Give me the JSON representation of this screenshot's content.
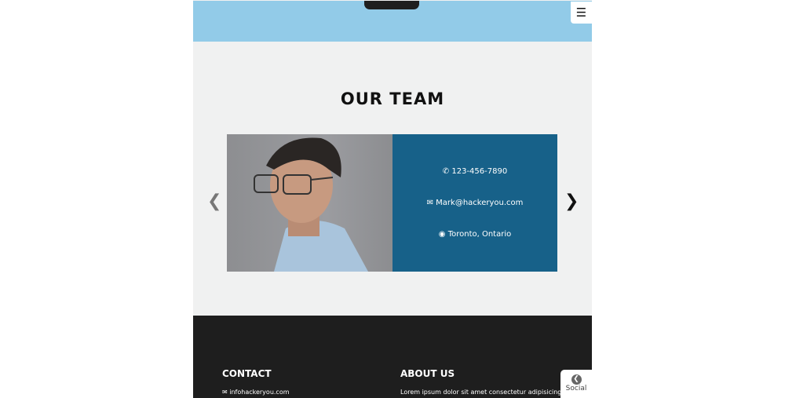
{
  "header": {
    "menu_icon": "hamburger-icon"
  },
  "team": {
    "title": "OUR TEAM",
    "prev_icon": "chevron-left-icon",
    "next_icon": "chevron-right-icon",
    "member": {
      "phone": "123-456-7890",
      "email": "Mark@hackeryou.com",
      "location": "Toronto, Ontario"
    }
  },
  "footer": {
    "contact": {
      "heading": "CONTACT",
      "email": "infohackeryou.com"
    },
    "about": {
      "heading": "ABOUT US",
      "text": "Lorem ipsum dolor sit amet consectetur adipisicing elit. Vitae"
    }
  },
  "social_tab": {
    "label": "Social"
  },
  "colors": {
    "header": "#92cbe8",
    "card": "#176189",
    "footer": "#1e1e1e"
  }
}
